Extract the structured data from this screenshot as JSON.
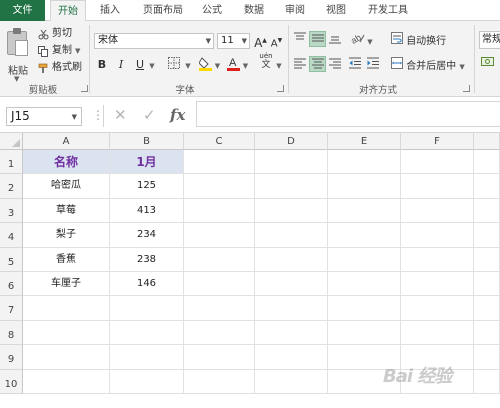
{
  "tabs": [
    "文件",
    "开始",
    "插入",
    "页面布局",
    "公式",
    "数据",
    "审阅",
    "视图",
    "开发工具"
  ],
  "clipboard": {
    "paste_label": "粘贴",
    "cut_label": "剪切",
    "copy_label": "复制",
    "format_painter_label": "格式刷",
    "group_label": "剪贴板"
  },
  "font": {
    "name": "宋体",
    "size": "11",
    "bold": "B",
    "italic": "I",
    "underline": "U",
    "grow": "A",
    "shrink": "A",
    "group_label": "字体",
    "phonetic": "文"
  },
  "alignment": {
    "wrap_label": "自动换行",
    "merge_label": "合并后居中",
    "group_label": "对齐方式"
  },
  "number": {
    "format_label": "常规"
  },
  "formula_bar": {
    "name_box": "J15",
    "fx": "fx",
    "cancel_icon": "✕",
    "enter_icon": "✓"
  },
  "columns": [
    "A",
    "B",
    "C",
    "D",
    "E",
    "F"
  ],
  "rows": [
    "1",
    "2",
    "3",
    "4",
    "5",
    "6",
    "7",
    "8",
    "9",
    "10"
  ],
  "table": {
    "header": [
      "名称",
      "1月"
    ],
    "data": [
      [
        "哈密瓜",
        "125"
      ],
      [
        "草莓",
        "413"
      ],
      [
        "梨子",
        "234"
      ],
      [
        "香蕉",
        "238"
      ],
      [
        "车厘子",
        "146"
      ]
    ]
  },
  "watermark": "Bai 经验",
  "colors": {
    "file_tab": "#217346",
    "header_fill": "#dbe3f1",
    "header_text": "#7030a0",
    "font_color": "#e0201b",
    "highlight": "#ffd800"
  }
}
